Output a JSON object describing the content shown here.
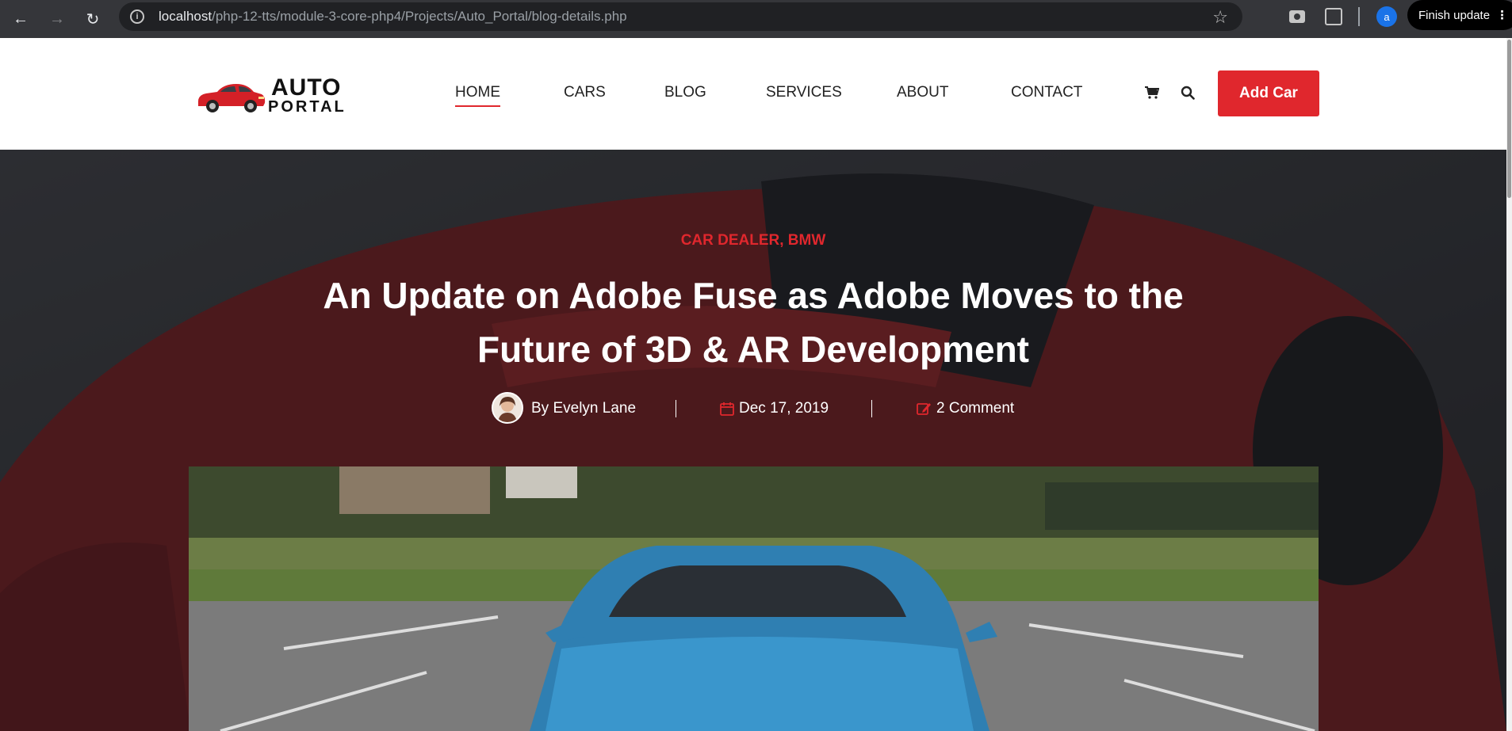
{
  "browser": {
    "url_host": "localhost",
    "url_path": "/php-12-tts/module-3-core-php4/Projects/Auto_Portal/blog-details.php",
    "profile_initial": "a",
    "finish_update_label": "Finish update"
  },
  "header": {
    "logo_line1": "AUTO",
    "logo_line2": "PORTAL",
    "menu": [
      {
        "label": "HOME"
      },
      {
        "label": "CARS"
      },
      {
        "label": "BLOG"
      },
      {
        "label": "SERVICES"
      },
      {
        "label": "ABOUT"
      },
      {
        "label": "CONTACT"
      }
    ],
    "add_car_label": "Add Car",
    "accent_color": "#e0272d"
  },
  "post": {
    "categories": "CAR DEALER, BMW",
    "title": "An Update on Adobe Fuse as Adobe Moves to the Future of 3D & AR Development",
    "author": "By Evelyn Lane",
    "date": "Dec 17, 2019",
    "comments": "2 Comment"
  }
}
